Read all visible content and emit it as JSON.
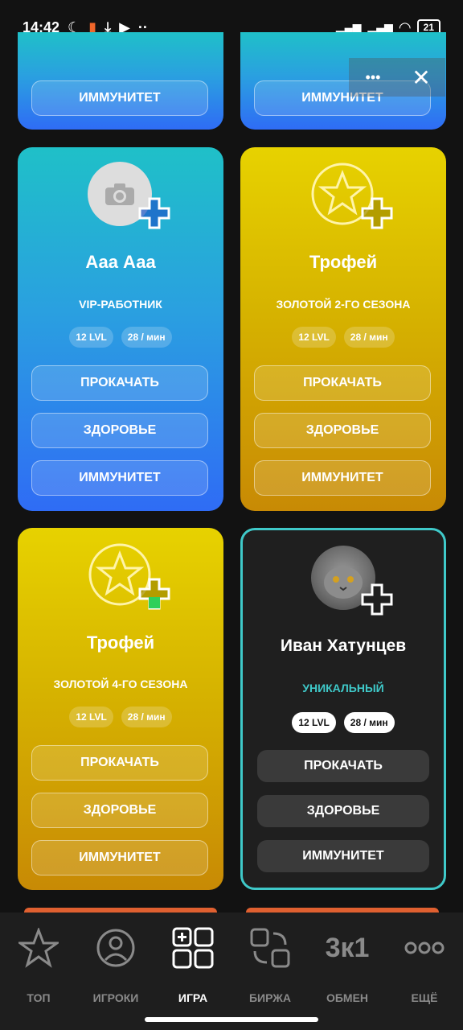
{
  "status_bar": {
    "time": "14:42",
    "battery": "21"
  },
  "top_buttons": {
    "more": "•••",
    "close": "✕"
  },
  "top_cards": [
    {
      "button": "ИММУНИТЕТ"
    },
    {
      "button": "ИММУНИТЕТ"
    }
  ],
  "cards": [
    {
      "name": "Ааа Ааа",
      "role": "VIP-РАБОТНИК",
      "level": "12 LVL",
      "rate": "28 / мин",
      "buttons": [
        "ПРОКАЧАТЬ",
        "ЗДОРОВЬЕ",
        "ИММУНИТЕТ"
      ],
      "theme": "blue"
    },
    {
      "name": "Трофей",
      "role": "ЗОЛОТОЙ 2-ГО СЕЗОНА",
      "level": "12 LVL",
      "rate": "28 / мин",
      "buttons": [
        "ПРОКАЧАТЬ",
        "ЗДОРОВЬЕ",
        "ИММУНИТЕТ"
      ],
      "theme": "gold"
    },
    {
      "name": "Трофей",
      "role": "ЗОЛОТОЙ 4-ГО СЕЗОНА",
      "level": "12 LVL",
      "rate": "28 / мин",
      "buttons": [
        "ПРОКАЧАТЬ",
        "ЗДОРОВЬЕ",
        "ИММУНИТЕТ"
      ],
      "theme": "gold"
    },
    {
      "name": "Иван Хатунцев",
      "role": "УНИКАЛЬНЫЙ",
      "level": "12 LVL",
      "rate": "28 / мин",
      "buttons": [
        "ПРОКАЧАТЬ",
        "ЗДОРОВЬЕ",
        "ИММУНИТЕТ"
      ],
      "theme": "dark"
    }
  ],
  "colors": {
    "accent_teal": "#3fc9c9",
    "orange_peek": "#e06030"
  },
  "tabs": [
    {
      "label": "ТОП",
      "icon": "star-icon"
    },
    {
      "label": "ИГРОКИ",
      "icon": "user-circle-icon"
    },
    {
      "label": "ИГРА",
      "icon": "grid-plus-icon",
      "active": true
    },
    {
      "label": "БИРЖА",
      "icon": "exchange-icon"
    },
    {
      "label": "ОБМЕН",
      "icon": "three-to-one-icon",
      "icon_text": "3к1"
    },
    {
      "label": "ЕЩЁ",
      "icon": "more-dots-icon"
    }
  ]
}
